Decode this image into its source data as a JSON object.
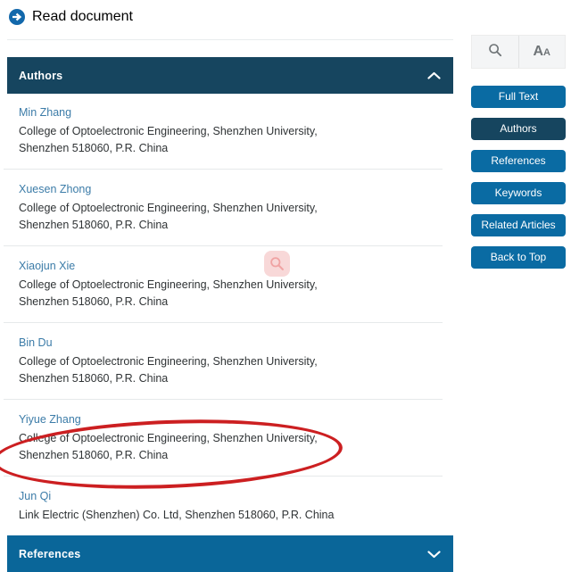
{
  "top_link": {
    "label": "Read document",
    "icon": "circle-arrow-right-icon"
  },
  "sections": {
    "authors": {
      "title": "Authors",
      "state": "expanded",
      "chevron": "chevron-up-icon"
    },
    "references": {
      "title": "References",
      "state": "collapsed",
      "chevron": "chevron-down-icon"
    }
  },
  "authors": [
    {
      "name": "Min Zhang",
      "affiliation": "College of Optoelectronic Engineering, Shenzhen University, Shenzhen 518060, P.R. China"
    },
    {
      "name": "Xuesen Zhong",
      "affiliation": "College of Optoelectronic Engineering, Shenzhen University, Shenzhen 518060, P.R. China"
    },
    {
      "name": "Xiaojun Xie",
      "affiliation": "College of Optoelectronic Engineering, Shenzhen University, Shenzhen 518060, P.R. China"
    },
    {
      "name": "Bin Du",
      "affiliation": "College of Optoelectronic Engineering, Shenzhen University, Shenzhen 518060, P.R. China"
    },
    {
      "name": "Yiyue Zhang",
      "affiliation": "College of Optoelectronic Engineering, Shenzhen University, Shenzhen 518060, P.R. China"
    },
    {
      "name": "Jun Qi",
      "affiliation": "Link Electric (Shenzhen) Co. Ltd, Shenzhen 518060, P.R. China"
    }
  ],
  "sidebar": {
    "view_tools": [
      {
        "name": "search-icon",
        "label": ""
      },
      {
        "name": "font-size-icon",
        "big": "A",
        "small": "A"
      }
    ],
    "nav_buttons": [
      {
        "label": "Full Text",
        "active": false
      },
      {
        "label": "Authors",
        "active": true
      },
      {
        "label": "References",
        "active": false
      },
      {
        "label": "Keywords",
        "active": false
      },
      {
        "label": "Related Articles",
        "active": false
      },
      {
        "label": "Back to Top",
        "active": false
      }
    ]
  },
  "annotations": {
    "highlight_ellipse": {
      "shape": "ellipse",
      "color": "#cc1f21",
      "targets": "Jun Qi / Link Electric (Shenzhen) Co. Ltd, Shenzhen 518060, P.R. China"
    },
    "click_indicator": {
      "icon": "magnifier-cursor-icon",
      "color": "#e57373"
    }
  },
  "colors": {
    "navy": "#16455f",
    "blue": "#0a6699",
    "button_blue": "#0a6ba3",
    "link_blue": "#3c7ca8",
    "annotation_red": "#cc1f21"
  }
}
